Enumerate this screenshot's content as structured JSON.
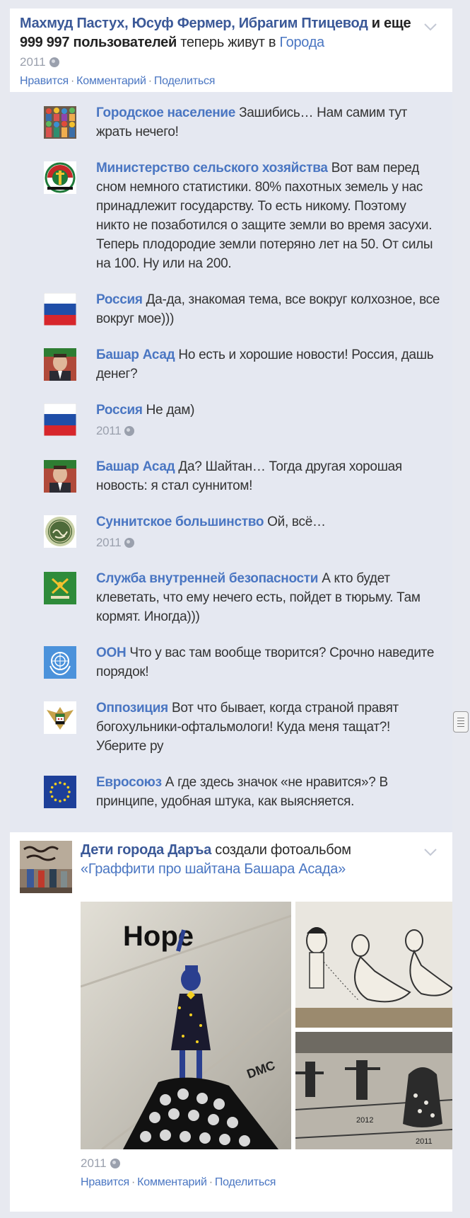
{
  "post1": {
    "names": "Махмуд Пастух, Юсуф Фермер, Ибрагим Птицевод",
    "and_more": " и еще",
    "count": "999 997 пользователей",
    "live_in": " теперь живут в ",
    "place": "Города",
    "year": "2011",
    "like": "Нравится",
    "comment": "Комментарий",
    "share": "Поделиться"
  },
  "comments": [
    {
      "author": "Городское население",
      "text": "Зашибись… Нам самим тут жрать нечего!",
      "avatar": "crowd-avatar"
    },
    {
      "author": "Министерство сельского хозяйства",
      "text": "Вот вам перед сном немного статистики. 80% пахотных земель у нас принадлежит государству. То есть никому. Поэтому никто не позаботился о защите земли во время засухи. Теперь плодородие земли потеряно лет на 50. От силы на 100. Ну или на 200.",
      "avatar": "ministry-emblem"
    },
    {
      "author": "Россия",
      "text": "Да-да, знакомая тема, все вокруг колхозное, все вокруг мое)))",
      "avatar": "russia-flag"
    },
    {
      "author": "Башар Асад",
      "text": "Но есть и хорошие новости! Россия, дашь денег?",
      "avatar": "assad-photo"
    },
    {
      "author": "Россия",
      "text": "Не дам)",
      "year": "2011",
      "avatar": "russia-flag"
    },
    {
      "author": "Башар Асад",
      "text": "Да? Шайтан… Тогда другая хорошая новость: я стал суннитом!",
      "avatar": "assad-photo"
    },
    {
      "author": "Суннитское большинство",
      "text": "Ой, всё…",
      "year": "2011",
      "avatar": "sunni-emblem"
    },
    {
      "author": "Служба внутренней безопасности",
      "text": "А кто будет клеветать, что ему нечего есть, пойдет в тюрьму. Там кормят. Иногда)))",
      "avatar": "security-emblem"
    },
    {
      "author": "ООН",
      "text": "Что у вас там вообще творится? Срочно наведите порядок!",
      "avatar": "un-emblem"
    },
    {
      "author": "Оппозиция",
      "text": "Вот что бывает, когда страной правят богохульники-офтальмологи! Куда меня тащат?! Уберите ру",
      "avatar": "opposition-emblem"
    },
    {
      "author": "Евросоюз",
      "text": "А где здесь значок «не нравится»? В принципе, удобная штука, как выясняется.",
      "avatar": "eu-flag"
    }
  ],
  "post2": {
    "author": "Дети города Даръа",
    "action": " создали фотоальбом",
    "album": "«Граффити про шайтана Башара Асада»",
    "photo_text_hope": "Hope",
    "photo_text_dmc": "DMC",
    "photo_year_1": "2012",
    "photo_year_2": "2011",
    "year": "2011",
    "like": "Нравится",
    "comment": "Комментарий",
    "share": "Поделиться"
  }
}
